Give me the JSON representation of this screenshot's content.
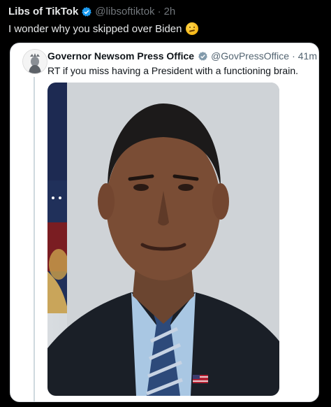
{
  "outer_tweet": {
    "display_name": "Libs of TikTok",
    "handle": "@libsoftiktok",
    "separator": "·",
    "time": "2h",
    "text": "I wonder why you skipped over Biden",
    "emoji_icon": "thinking-face-icon"
  },
  "quoted_tweet": {
    "display_name": "Governor Newsom Press Office",
    "handle": "@GovPressOffice",
    "separator": "·",
    "time": "41m",
    "text": "RT if you miss having a President with a functioning brain.",
    "verified_icon": "gray-verified-badge-icon"
  },
  "colors": {
    "background": "#000000",
    "blue_badge": "#1d9bf0",
    "gray_badge": "#829aab",
    "card_bg": "#ffffff"
  }
}
